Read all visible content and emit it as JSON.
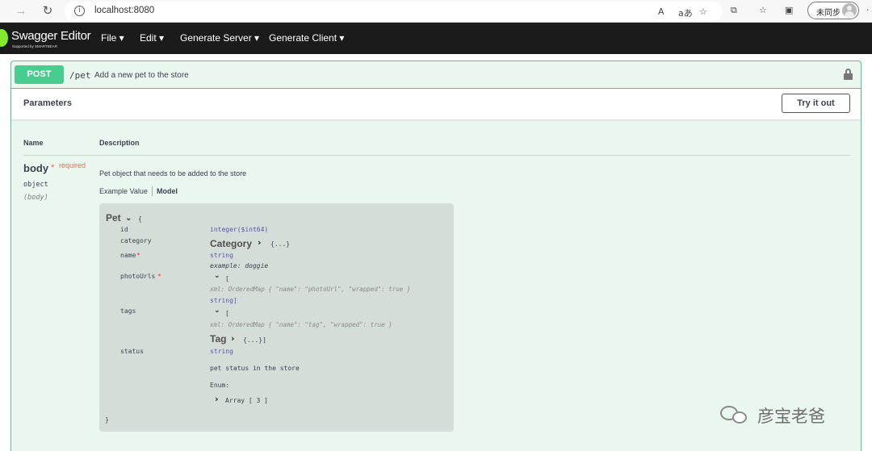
{
  "browser": {
    "url": "localhost:8080",
    "sync_label": "未同步",
    "icons": [
      "back-arrow-icon",
      "refresh-icon",
      "info-icon",
      "read-aloud-icon",
      "translate-icon",
      "favorite-star-icon",
      "extensions-icon",
      "favorites-icon",
      "collections-icon",
      "more-icon"
    ],
    "read_aloud_glyph": "A",
    "translate_glyph": "aあ"
  },
  "app": {
    "brand": "Swagger Editor",
    "brand_sub": "Supported by SMARTBEAR",
    "menu": [
      "File ▾",
      "Edit ▾",
      "Generate Server ▾",
      "Generate Client ▾"
    ]
  },
  "operation": {
    "method": "POST",
    "path": "/pet",
    "summary": "Add a new pet to the store",
    "colors": {
      "accent": "#49cc90",
      "background": "#eaf7ee"
    }
  },
  "parameters": {
    "title": "Parameters",
    "try_label": "Try it out",
    "col_name": "Name",
    "col_desc": "Description",
    "param": {
      "name": "body",
      "star": "*",
      "required_label": "required",
      "type": "object",
      "in": "(body)",
      "description": "Pet object that needs to be added to the store",
      "tab_example": "Example Value",
      "tab_model": "Model"
    }
  },
  "model": {
    "name": "Pet",
    "open": "{",
    "close": "}",
    "props": {
      "id": {
        "name": "id",
        "type": "integer($int64)"
      },
      "category": {
        "name": "category",
        "ref": "Category",
        "collapsed": "{...}"
      },
      "name": {
        "name": "name",
        "star": "*",
        "type": "string",
        "example": "example: doggie"
      },
      "photoUrls": {
        "name": "photoUrls",
        "star": "*",
        "open": "[",
        "xml": "xml: OrderedMap { \"name\": \"photoUrl\", \"wrapped\": true }",
        "items": "string]"
      },
      "tags": {
        "name": "tags",
        "open": "[",
        "xml": "xml: OrderedMap { \"name\": \"tag\", \"wrapped\": true }",
        "ref": "Tag",
        "collapsed": "{...}]"
      },
      "status": {
        "name": "status",
        "type": "string",
        "description": "pet status in the store",
        "enum_label": "Enum:",
        "enum_value": "Array [ 3 ]"
      }
    }
  },
  "watermark": {
    "text": "彦宝老爸"
  }
}
